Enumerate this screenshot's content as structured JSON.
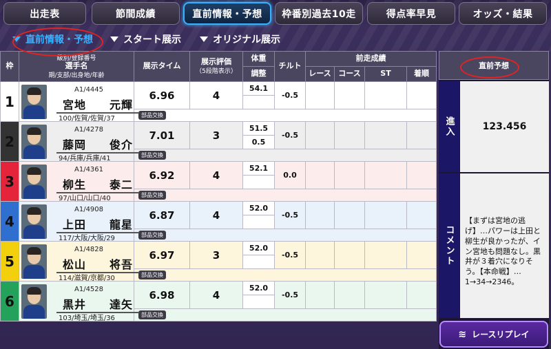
{
  "tabs": [
    "出走表",
    "節間成績",
    "直前情報・予想",
    "枠番別過去10走",
    "得点率早見",
    "オッズ・結果"
  ],
  "subnav": [
    "直前情報・予想",
    "スタート展示",
    "オリジナル展示"
  ],
  "headers": {
    "waku": "枠",
    "racer_l1": "級別/登録番号",
    "racer_l2": "選手名",
    "racer_l3": "期/支部/出身地/年齢",
    "tenji_time": "展示タイム",
    "tenji_eval_l1": "展示評価",
    "tenji_eval_l2": "（5段階表示）",
    "weight_l1": "体重",
    "weight_l2": "調整",
    "tilt": "チルト",
    "prev_results": "前走成績",
    "race": "レース",
    "course": "コース",
    "st": "ST",
    "rank": "着順"
  },
  "rows": [
    {
      "waku": "1",
      "cls": "A1/4445",
      "name": "宮地　　元輝",
      "info": "100/佐賀/佐賀/37",
      "time": "6.96",
      "eval": "4",
      "weight": "54.1",
      "adjust": "",
      "tilt": "-0.5",
      "parts": "部品交換"
    },
    {
      "waku": "2",
      "cls": "A1/4278",
      "name": "藤岡　　俊介",
      "info": "94/兵庫/兵庫/41",
      "time": "7.01",
      "eval": "3",
      "weight": "51.5",
      "adjust": "0.5",
      "tilt": "-0.5",
      "parts": "部品交換"
    },
    {
      "waku": "3",
      "cls": "A1/4361",
      "name": "柳生　　泰二",
      "info": "97/山口/山口/40",
      "time": "6.92",
      "eval": "4",
      "weight": "52.1",
      "adjust": "",
      "tilt": "0.0",
      "parts": "部品交換"
    },
    {
      "waku": "4",
      "cls": "A1/4908",
      "name": "上田　　龍星",
      "info": "117/大阪/大阪/29",
      "time": "6.87",
      "eval": "4",
      "weight": "52.0",
      "adjust": "",
      "tilt": "-0.5",
      "parts": "部品交換"
    },
    {
      "waku": "5",
      "cls": "A1/4828",
      "name": "松山　　将吾",
      "info": "114/滋賀/京都/30",
      "time": "6.97",
      "eval": "3",
      "weight": "52.0",
      "adjust": "",
      "tilt": "-0.5",
      "parts": "部品交換"
    },
    {
      "waku": "6",
      "cls": "A1/4528",
      "name": "黒井　　達矢",
      "info": "103/埼玉/埼玉/36",
      "time": "6.98",
      "eval": "4",
      "weight": "52.0",
      "adjust": "",
      "tilt": "-0.5",
      "parts": "部品交換"
    }
  ],
  "side": {
    "title": "直前予想",
    "entry_label": "進入",
    "entry_value": "123.456",
    "comment_label": "コメント",
    "comment": "【まずは宮地の逃げ】…パワーは上田と柳生が良かったが、イン宮地も問題なし。黒井が３着穴になりそう。【本命戦】…1→34→2346。",
    "replay": "レースリプレイ"
  },
  "colors": {
    "accent": "#3ab1ff",
    "annotation": "#e32222",
    "header_bg": "#4a4660"
  }
}
